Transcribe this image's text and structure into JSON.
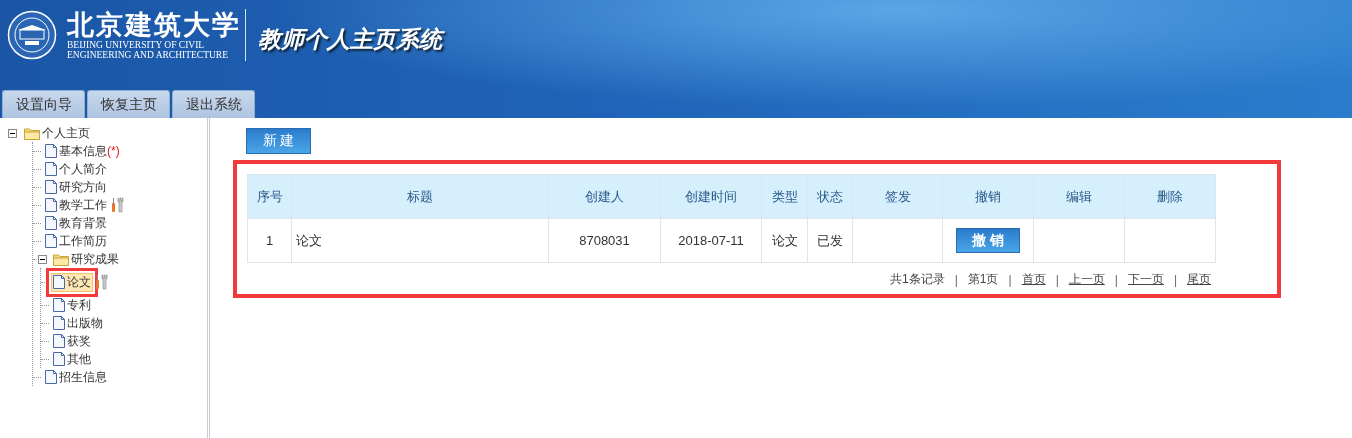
{
  "header": {
    "logo_name": "北京建筑大学",
    "logo_subtitle": [
      "BEIJING UNIVERSITY OF CIVIL",
      "ENGINEERING AND ARCHITECTURE"
    ],
    "system_title": "教师个人主页系统"
  },
  "tabs": [
    {
      "label": "设置向导"
    },
    {
      "label": "恢复主页"
    },
    {
      "label": "退出系统"
    }
  ],
  "tree": [
    {
      "label": "个人主页",
      "kind": "folder",
      "expanded": true,
      "children": [
        {
          "label": "基本信息",
          "kind": "page",
          "required_mark": "(*)",
          "tool_icon": false,
          "selected": false,
          "annotated": false
        },
        {
          "label": "个人简介",
          "kind": "page",
          "tool_icon": false,
          "selected": false,
          "annotated": false
        },
        {
          "label": "研究方向",
          "kind": "page",
          "tool_icon": false,
          "selected": false,
          "annotated": false
        },
        {
          "label": "教学工作",
          "kind": "page",
          "tool_icon": true,
          "selected": false,
          "annotated": false
        },
        {
          "label": "教育背景",
          "kind": "page",
          "tool_icon": false,
          "selected": false,
          "annotated": false
        },
        {
          "label": "工作简历",
          "kind": "page",
          "tool_icon": false,
          "selected": false,
          "annotated": false
        },
        {
          "label": "研究成果",
          "kind": "folder",
          "expanded": true,
          "children": [
            {
              "label": "论文",
              "kind": "page",
              "tool_icon": true,
              "selected": true,
              "annotated": true
            },
            {
              "label": "专利",
              "kind": "page",
              "tool_icon": false,
              "selected": false,
              "annotated": false
            },
            {
              "label": "出版物",
              "kind": "page",
              "tool_icon": false,
              "selected": false,
              "annotated": false
            },
            {
              "label": "获奖",
              "kind": "page",
              "tool_icon": false,
              "selected": false,
              "annotated": false
            },
            {
              "label": "其他",
              "kind": "page",
              "tool_icon": false,
              "selected": false,
              "annotated": false
            }
          ]
        },
        {
          "label": "招生信息",
          "kind": "page",
          "tool_icon": false,
          "selected": false,
          "annotated": false
        }
      ]
    }
  ],
  "new_button": "新 建",
  "table_panel": {
    "annotated": true,
    "columns": [
      "序号",
      "标题",
      "创建人",
      "创建时间",
      "类型",
      "状态",
      "签发",
      "撤销",
      "编辑",
      "删除"
    ],
    "rows": [
      {
        "cells": [
          "1",
          "论文",
          "8708031",
          "2018-07-11",
          "论文",
          "已发",
          ""
        ],
        "revoke_button": "撤 销"
      }
    ],
    "pagination": {
      "summary": "共1条记录",
      "page": "第1页",
      "separator": "|",
      "links": [
        "首页",
        "上一页",
        "下一页",
        "尾页"
      ]
    }
  }
}
